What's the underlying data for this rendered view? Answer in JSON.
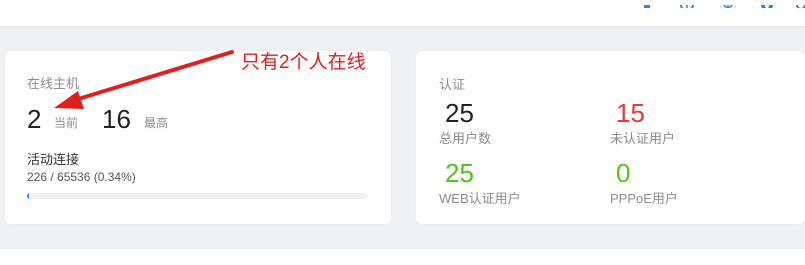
{
  "online_hosts": {
    "title": "在线主机",
    "current_value": "2",
    "current_label": "当前",
    "max_value": "16",
    "max_label": "最高",
    "active_conn_title": "活动连接",
    "active_conn_stat": "226 / 65536 (0.34%)",
    "active_conn_fraction": 0.0034
  },
  "auth": {
    "title": "认证",
    "stats": [
      {
        "value": "25",
        "label": "总用户数",
        "color": "#222222"
      },
      {
        "value": "15",
        "label": "未认证用户",
        "color": "#e53935"
      },
      {
        "value": "25",
        "label": "WEB认证用户",
        "color": "#52c41a"
      },
      {
        "value": "0",
        "label": "PPPoE用户",
        "color": "#52c41a"
      }
    ]
  },
  "annotation": {
    "text": "只有2个人在线",
    "color": "#e02020"
  },
  "colors": {
    "accent": "#1890ff",
    "background": "#eef0f3"
  }
}
